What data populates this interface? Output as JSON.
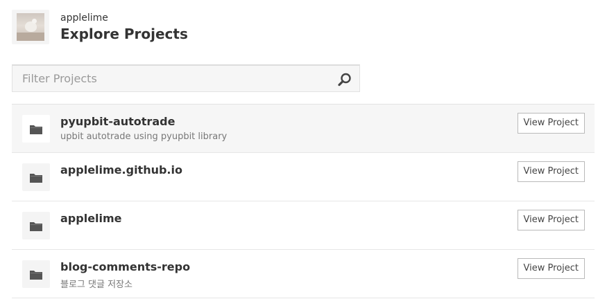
{
  "header": {
    "owner": "applelime",
    "title": "Explore Projects"
  },
  "search": {
    "placeholder": "Filter Projects",
    "value": ""
  },
  "projects": [
    {
      "name": "pyupbit-autotrade",
      "description": "upbit autotrade using pyupbit library",
      "button_label": "View Project",
      "highlighted": true
    },
    {
      "name": "applelime.github.io",
      "description": "",
      "button_label": "View Project",
      "highlighted": false
    },
    {
      "name": "applelime",
      "description": "",
      "button_label": "View Project",
      "highlighted": false
    },
    {
      "name": "blog-comments-repo",
      "description": "블로그 댓글 저장소",
      "button_label": "View Project",
      "highlighted": false
    }
  ],
  "icons": {
    "search": "search-icon",
    "folder": "folder-icon"
  },
  "colors": {
    "text": "#333333",
    "muted": "#777777",
    "highlight_row": "#f6f6f6",
    "icon": "#555555"
  }
}
